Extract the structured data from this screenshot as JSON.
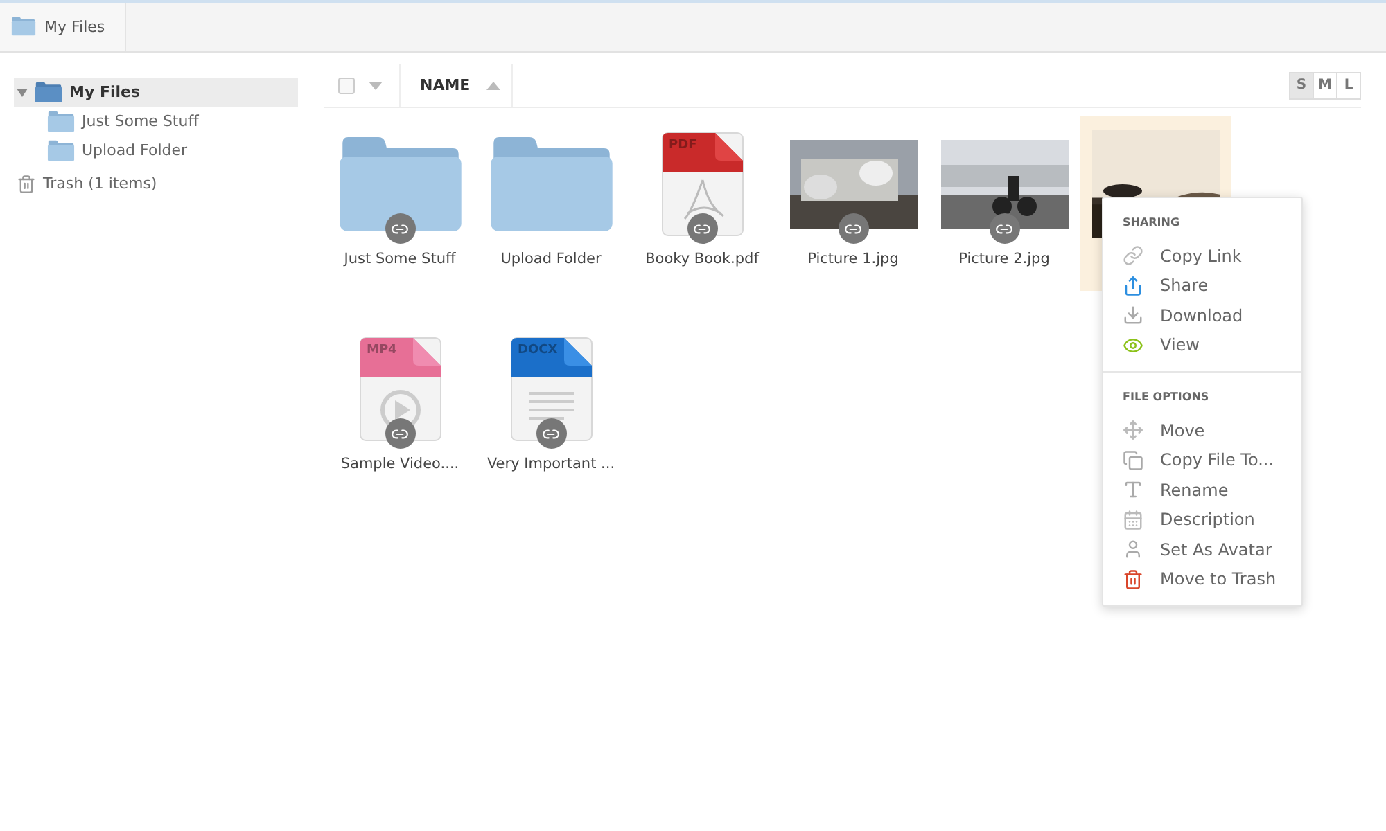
{
  "breadcrumb": [
    {
      "label": "My Files"
    }
  ],
  "tree": [
    {
      "label": "My Files",
      "expanded": true,
      "selected": true,
      "children": [
        {
          "label": "Just Some Stuff",
          "selected": false
        },
        {
          "label": "Upload Folder",
          "selected": false
        }
      ]
    }
  ],
  "trash": {
    "label": "Trash (1 items)"
  },
  "header": {
    "checked": false,
    "column": "NAME",
    "sizes": [
      {
        "label": "S",
        "selected": true
      },
      {
        "label": "M",
        "selected": false
      },
      {
        "label": "L",
        "selected": false
      }
    ]
  },
  "files": [
    {
      "kind": "folder",
      "name": "Just Some Stuff",
      "shared": true,
      "selected": false
    },
    {
      "kind": "folder",
      "name": "Upload Folder",
      "shared": false,
      "selected": false
    },
    {
      "kind": "doc",
      "badge": "PDF",
      "name": "Booky Book.pdf",
      "shared": true,
      "selected": false
    },
    {
      "kind": "picture",
      "name": "Picture 1.jpg",
      "shared": true,
      "selected": false
    },
    {
      "kind": "picture",
      "name": "Picture 2.jpg",
      "shared": true,
      "selected": false
    },
    {
      "kind": "picture",
      "shared": false,
      "selected": true
    },
    {
      "kind": "doc",
      "badge": "MP4",
      "name": "Sample Video....",
      "shared": true,
      "selected": false
    },
    {
      "kind": "doc",
      "badge": "DOCX",
      "name": "Very Important ...",
      "shared": true,
      "selected": false
    }
  ],
  "menu": [
    {
      "title": "SHARING",
      "items": [
        {
          "kind": "link",
          "label": "Copy Link"
        },
        {
          "kind": "share",
          "label": "Share"
        },
        {
          "kind": "download",
          "label": "Download"
        },
        {
          "kind": "view",
          "label": "View"
        }
      ]
    },
    {
      "title": "FILE OPTIONS",
      "items": [
        {
          "kind": "move",
          "label": "Move"
        },
        {
          "kind": "copy",
          "label": "Copy File To..."
        },
        {
          "kind": "rename",
          "label": "Rename"
        },
        {
          "kind": "description",
          "label": "Description"
        },
        {
          "kind": "avatar",
          "label": "Set As Avatar"
        },
        {
          "kind": "trash",
          "label": "Move to Trash"
        }
      ]
    }
  ]
}
